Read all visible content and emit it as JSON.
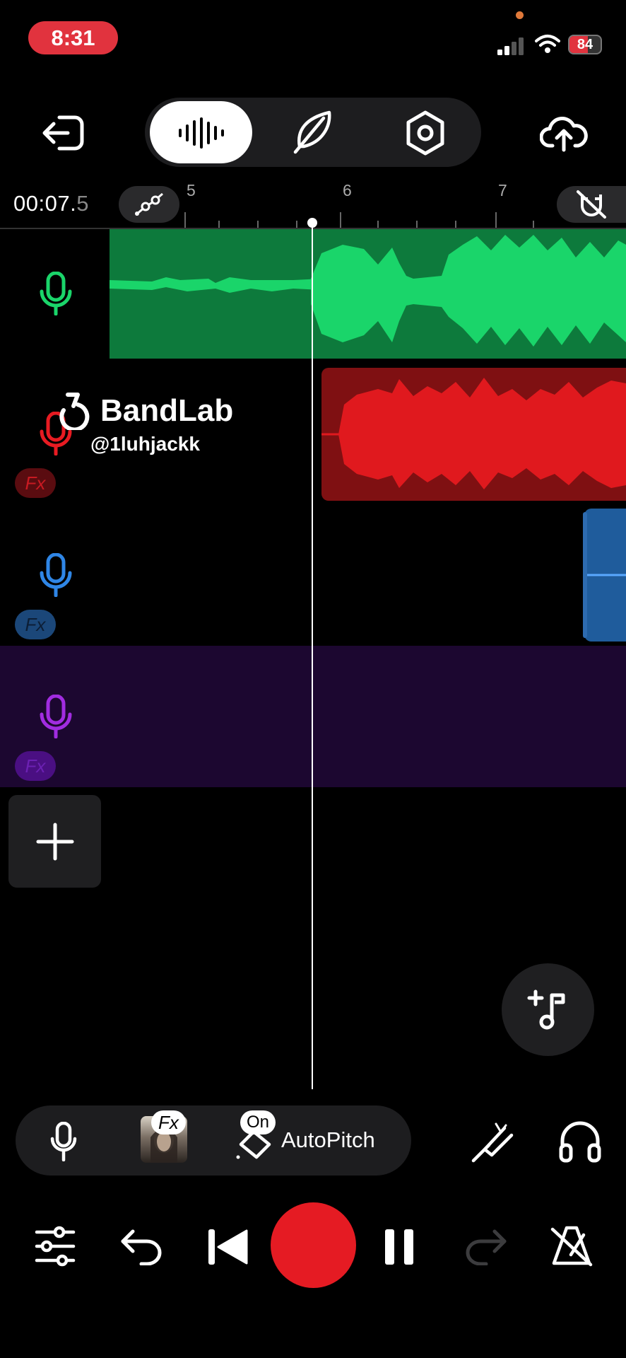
{
  "status_bar": {
    "time": "8:31",
    "battery": "84"
  },
  "header": {
    "modes": [
      {
        "name": "waveform",
        "active": true
      },
      {
        "name": "feather",
        "active": false
      },
      {
        "name": "settings",
        "active": false
      }
    ]
  },
  "timeline": {
    "timecode_main": "00:07.",
    "timecode_frac": "5",
    "ticks": [
      "5",
      "6",
      "7"
    ]
  },
  "tracks": [
    {
      "id": "track-1",
      "color": "#1ad56a",
      "fx": false
    },
    {
      "id": "track-2",
      "color": "#e81b22",
      "fx": true,
      "fx_label": "Fx"
    },
    {
      "id": "track-3",
      "color": "#2f86e6",
      "fx": true,
      "fx_label": "Fx"
    },
    {
      "id": "track-4",
      "color": "#a12ce0",
      "fx": true,
      "fx_label": "Fx"
    }
  ],
  "watermark": {
    "brand": "BandLab",
    "handle": "@1luhjackk"
  },
  "tool_bar": {
    "fx_label": "Fx",
    "on_label": "On",
    "autopitch_label": "AutoPitch"
  },
  "colors": {
    "accent_red": "#e51b23",
    "green_clip": "#0d7a3c",
    "green_wave": "#1ad56a",
    "red_clip": "#7f1012",
    "red_wave": "#e0191e",
    "blue_clip": "#1f5c9c",
    "purple_lane": "#1c0730"
  }
}
